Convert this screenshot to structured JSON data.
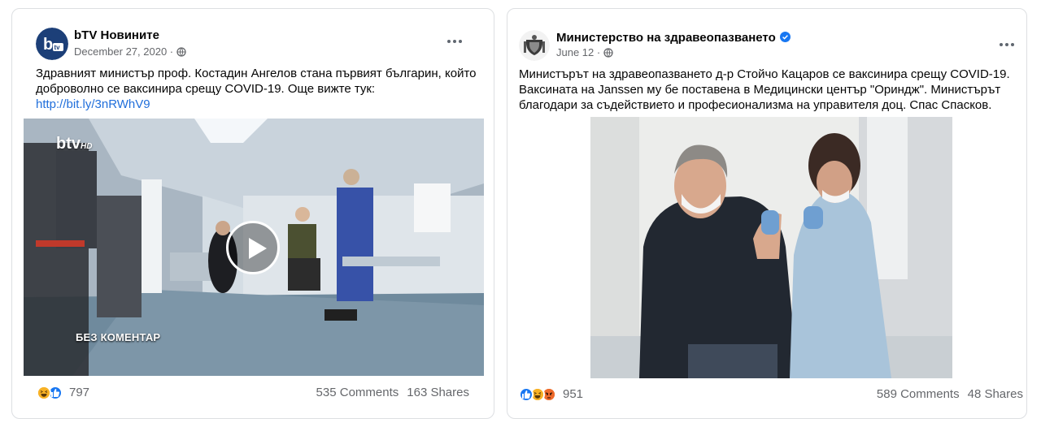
{
  "posts": [
    {
      "author": "bTV Новините",
      "date": "December 27, 2020 ·",
      "text_lines": [
        "Здравният министър проф. Костадин Ангелов стана първият българин, който",
        "доброволно се ваксинира срещу COVID-19. Още вижте тук:"
      ],
      "link": "http://bit.ly/3nRWhV9",
      "video_caption": "БЕЗ КОМЕНТАР",
      "channel_logo": "btv",
      "reaction_count": "797",
      "comments": "535 Comments",
      "shares": "163 Shares",
      "reactions": [
        "haha",
        "like"
      ]
    },
    {
      "author": "Министерство на здравеопазването",
      "date": "June 12 ·",
      "text_lines": [
        "Министърът на здравеопазването д-р Стойчо Кацаров се ваксинира срещу COVID-19.",
        "Ваксината на Janssen му бе поставена в Медицински център \"Ориндж\". Министърът",
        "благодари за съдействието и професионализма на управителя доц. Спас Спасков."
      ],
      "reaction_count": "951",
      "comments": "589 Comments",
      "shares": "48 Shares",
      "reactions": [
        "like",
        "haha",
        "angry"
      ]
    }
  ],
  "colors": {
    "link": "#216fdb",
    "meta": "#65676b",
    "like": "#1877f2",
    "haha": "#f7b125",
    "angry": "#e9710f"
  },
  "icons": [
    "globe-icon",
    "more-options-icon",
    "verified-badge-icon",
    "play-icon",
    "like-reaction-icon",
    "haha-reaction-icon",
    "angry-reaction-icon"
  ]
}
